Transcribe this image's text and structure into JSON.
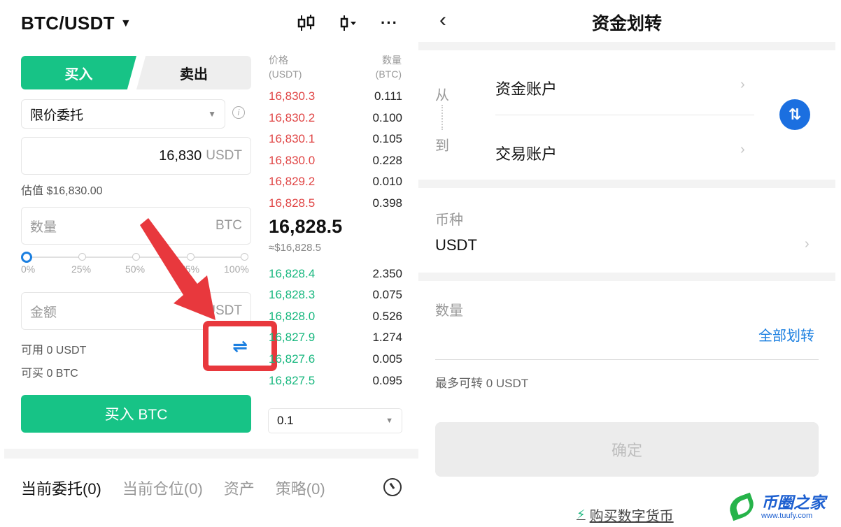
{
  "left": {
    "pair": "BTC/USDT",
    "tabs": {
      "buy": "买入",
      "sell": "卖出"
    },
    "order_type": "限价委托",
    "price_field": {
      "value": "16,830",
      "unit": "USDT"
    },
    "estimate": "估值 $16,830.00",
    "qty_field": {
      "placeholder": "数量",
      "unit": "BTC"
    },
    "slider": {
      "labels": [
        "0%",
        "25%",
        "50%",
        "75%",
        "100%"
      ],
      "value_percent": 0
    },
    "amount_field": {
      "placeholder": "金额",
      "unit": "USDT"
    },
    "available_usdt": "可用 0 USDT",
    "can_buy_btc": "可买 0 BTC",
    "buy_button": "买入 BTC",
    "orderbook": {
      "price_header": [
        "价格",
        "(USDT)"
      ],
      "qty_header": [
        "数量",
        "(BTC)"
      ],
      "asks": [
        {
          "price": "16,830.3",
          "qty": "0.111"
        },
        {
          "price": "16,830.2",
          "qty": "0.100"
        },
        {
          "price": "16,830.1",
          "qty": "0.105"
        },
        {
          "price": "16,830.0",
          "qty": "0.228"
        },
        {
          "price": "16,829.2",
          "qty": "0.010"
        },
        {
          "price": "16,828.5",
          "qty": "0.398"
        }
      ],
      "mid_price": "16,828.5",
      "mid_price_usd": "≈$16,828.5",
      "bids": [
        {
          "price": "16,828.4",
          "qty": "2.350"
        },
        {
          "price": "16,828.3",
          "qty": "0.075"
        },
        {
          "price": "16,828.0",
          "qty": "0.526"
        },
        {
          "price": "16,827.9",
          "qty": "1.274"
        },
        {
          "price": "16,827.6",
          "qty": "0.005"
        },
        {
          "price": "16,827.5",
          "qty": "0.095"
        }
      ],
      "depth": "0.1"
    },
    "bottom_tabs": [
      "当前委托(0)",
      "当前仓位(0)",
      "资产",
      "策略(0)"
    ]
  },
  "right": {
    "title": "资金划转",
    "from_label": "从",
    "to_label": "到",
    "from_account": "资金账户",
    "to_account": "交易账户",
    "coin_label": "币种",
    "coin_value": "USDT",
    "amount_label": "数量",
    "all_transfer": "全部划转",
    "max_transfer": "最多可转 0 USDT",
    "confirm": "确定",
    "buy_crypto": "购买数字货币"
  },
  "watermark": {
    "cn": "币圈之家",
    "url": "www.tuufy.com"
  },
  "colors": {
    "green": "#17c386",
    "red": "#e04545",
    "blue": "#1b7fe0",
    "highlight": "#e8383d"
  }
}
